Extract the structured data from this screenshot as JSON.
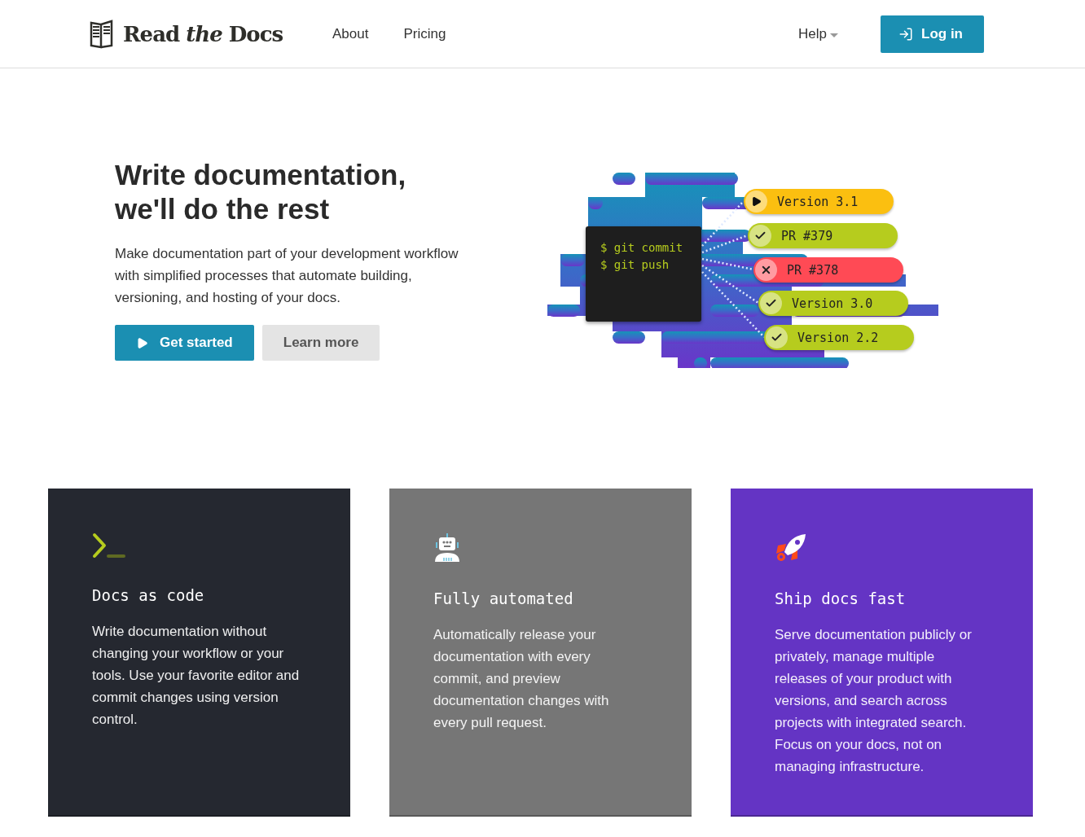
{
  "header": {
    "logo": "Read *the* Docs",
    "nav": [
      "About",
      "Pricing"
    ],
    "help": "Help",
    "login": "Log in"
  },
  "hero": {
    "title_lines": [
      "Write documentation,",
      "we'll do the rest"
    ],
    "text": "Make documentation part of your development workflow with simplified processes that automate building, versioning, and hosting of your docs.",
    "buttons": [
      {
        "label": "Get started",
        "kind": "primary"
      },
      {
        "label": "Learn more",
        "kind": "secondary"
      }
    ]
  },
  "illustration": {
    "terminal": [
      "$ git commit",
      "$ git push"
    ],
    "builds": [
      {
        "label": "Version 3.1",
        "kind": "running",
        "color": "#fbbf10"
      },
      {
        "label": "PR #379",
        "kind": "passed",
        "color": "#b6cc1e"
      },
      {
        "label": "PR #378",
        "kind": "failed",
        "color": "#ff4a55"
      },
      {
        "label": "Version 3.0",
        "kind": "passed",
        "color": "#b6cc1e"
      },
      {
        "label": "Version 2.2",
        "kind": "passed",
        "color": "#b6cc1e"
      }
    ]
  },
  "features": [
    {
      "title": "Docs as code",
      "text": "Write documentation without changing your workflow or your tools. Use your favorite editor and commit changes using version control.",
      "color": "#252830"
    },
    {
      "title": "Fully automated",
      "text": "Automatically release your documentation with every commit, and preview documentation changes with every pull request.",
      "color": "#767676"
    },
    {
      "title": "Ship docs fast",
      "text": "Serve documentation publicly or privately, manage multiple releases of your product with versions, and search across projects with integrated search. Focus on your docs, not on managing infrastructure.",
      "color": "#6434c4"
    }
  ]
}
